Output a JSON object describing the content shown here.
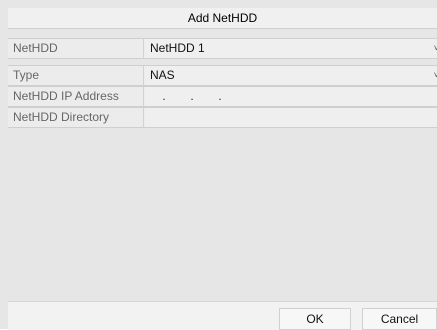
{
  "dialog": {
    "title": "Add NetHDD"
  },
  "fields": {
    "nethdd": {
      "label": "NetHDD",
      "value": "NetHDD 1"
    },
    "type": {
      "label": "Type",
      "value": "NAS"
    },
    "ip": {
      "label": "NetHDD IP Address",
      "dots": [
        ".",
        ".",
        "."
      ]
    },
    "directory": {
      "label": "NetHDD Directory",
      "value": ""
    }
  },
  "icons": {
    "dropdown": "chevron-down-icon",
    "chevron_glyph": "˅"
  },
  "buttons": {
    "ok": "OK",
    "cancel": "Cancel"
  }
}
